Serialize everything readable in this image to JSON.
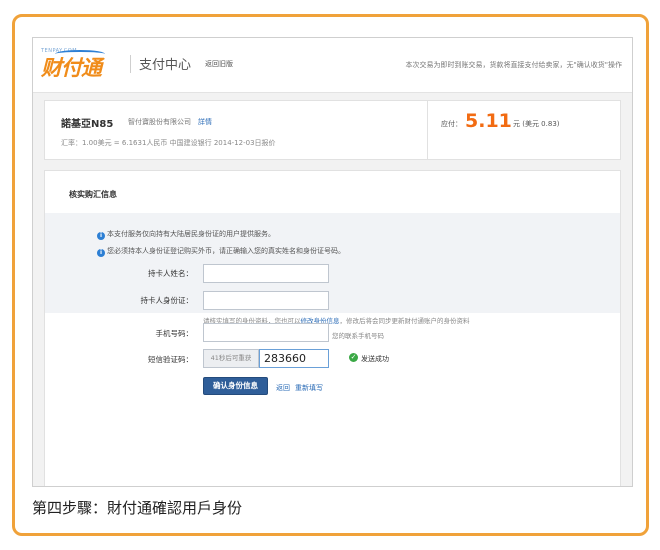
{
  "header": {
    "logo_small": "TENPAY.COM",
    "logo_text": "财付通",
    "center_title": "支付中心",
    "back_link": "返回旧版",
    "top_right": "本次交易为即时到账交易，货款将直接支付给卖家，无\"确认收货\"操作"
  },
  "merchant": {
    "name": "諾基亞N85",
    "company": "智付寶股份有限公司",
    "detail_link": "詳情",
    "rate": "汇率：1.00美元 = 6.1631人民币  中国建设银行 2014-12-03日报价",
    "pay_label": "应付：",
    "pay_amount": "5.11",
    "pay_unit": "元 (美元 0.83)"
  },
  "panel": {
    "title": "核实购汇信息",
    "notice1": "本支付服务仅向持有大陆居民身份证的用户提供服务。",
    "notice2": "您必须持本人身份证登记购买外币，请正确输入您的真实姓名和身份证号码。",
    "name_label": "持卡人姓名：",
    "name_value": "",
    "id_label": "持卡人身份证：",
    "id_value": "",
    "id_hint_pre": "请核实填写的身份资料，您也可以",
    "id_hint_link": "修改身份信息",
    "id_hint_post": "，修改后将会同步更新财付通账户的身份资料",
    "phone_label": "手机号码：",
    "phone_value": "",
    "phone_hint": "您的联系手机号码",
    "sms_label": "短信验证码：",
    "resend_label": "41秒后可重获",
    "sms_value": "283660",
    "sms_status": "发送成功",
    "confirm_label": "确认身份信息",
    "back_label": "返回",
    "refill_label": "重新填写"
  },
  "caption": "第四步驟：財付通確認用戶身份"
}
